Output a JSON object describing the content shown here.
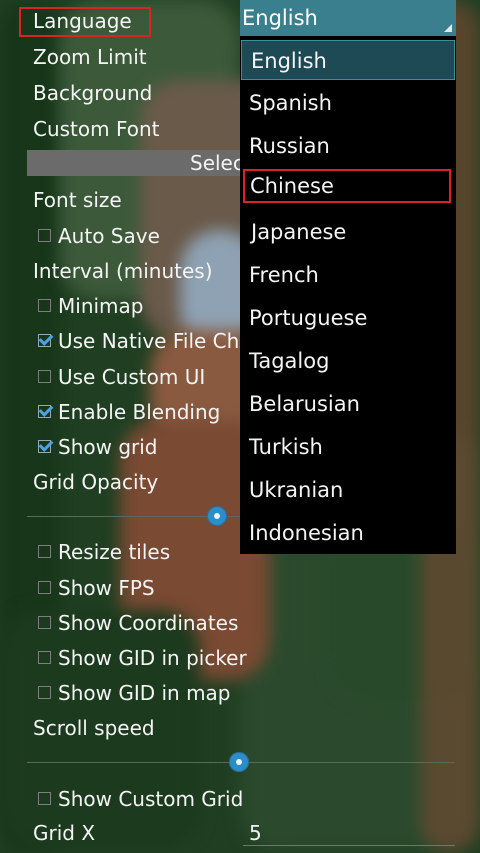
{
  "settings": {
    "language_label": "Language",
    "zoom_limit_label": "Zoom Limit",
    "background_label": "Background",
    "custom_font_label": "Custom Font",
    "select_button_label": "Selec",
    "font_size_label": "Font size",
    "auto_save_label": "Auto Save",
    "interval_label": "Interval (minutes)",
    "minimap_label": "Minimap",
    "native_file_chooser_label": "Use Native File Ch",
    "custom_ui_label": "Use Custom UI",
    "enable_blending_label": "Enable Blending",
    "show_grid_label": "Show grid",
    "grid_opacity_label": "Grid Opacity",
    "resize_tiles_label": "Resize tiles",
    "show_fps_label": "Show FPS",
    "show_coordinates_label": "Show Coordinates",
    "show_gid_picker_label": "Show GID in picker",
    "show_gid_map_label": "Show GID in map",
    "scroll_speed_label": "Scroll speed",
    "show_custom_grid_label": "Show Custom Grid",
    "grid_x_label": "Grid X",
    "grid_x_value": "5"
  },
  "checks": {
    "auto_save": false,
    "minimap": false,
    "native_file_chooser": true,
    "custom_ui": false,
    "enable_blending": true,
    "show_grid": true,
    "resize_tiles": false,
    "show_fps": false,
    "show_coordinates": false,
    "show_gid_picker": false,
    "show_gid_map": false,
    "show_custom_grid": false
  },
  "dropdown": {
    "selected": "English",
    "options": [
      "English",
      "Spanish",
      "Russian",
      "Chinese",
      "Japanese",
      "French",
      "Portuguese",
      "Tagalog",
      "Belarusian",
      "Turkish",
      "Ukranian",
      "Indonesian"
    ]
  },
  "colors": {
    "accent": "#2c8ec8",
    "highlight": "#dd2222",
    "dropdown_header": "#3a7f8e"
  }
}
